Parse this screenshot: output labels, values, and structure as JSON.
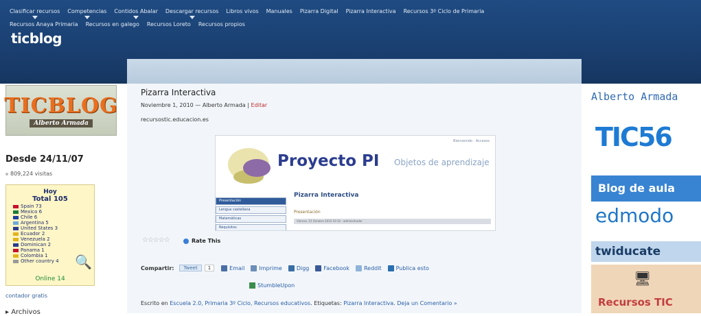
{
  "nav": {
    "row1": [
      {
        "label": "Clasificar recursos",
        "arrow": true
      },
      {
        "label": "Competencias",
        "arrow": true
      },
      {
        "label": "Contidos Abalar",
        "arrow": true
      },
      {
        "label": "Descargar recursos",
        "arrow": true
      },
      {
        "label": "Libros vivos",
        "arrow": false
      },
      {
        "label": "Manuales",
        "arrow": false
      },
      {
        "label": "Pizarra Digital",
        "arrow": false
      },
      {
        "label": "Pizarra Interactiva",
        "arrow": false
      },
      {
        "label": "Recursos 3º Ciclo de Primaria",
        "arrow": false
      }
    ],
    "row2": [
      {
        "label": "Recursos Anaya Primaria"
      },
      {
        "label": "Recursos en galego"
      },
      {
        "label": "Recursos Loreto"
      },
      {
        "label": "Recursos propios"
      }
    ]
  },
  "site": {
    "title": "ticblog"
  },
  "left": {
    "logo_big": "TICBLOG",
    "logo_small": "Alberto Armada",
    "since": "Desde 24/11/07",
    "visits": "809,224 visitas",
    "counter": {
      "hoy": "Hoy",
      "total": "Total 105",
      "rows": [
        {
          "label": "Spain 73",
          "color": "#c8102e"
        },
        {
          "label": "Mexico 6",
          "color": "#1b7a3a"
        },
        {
          "label": "Chile 6",
          "color": "#1f3fa0"
        },
        {
          "label": "Argentina 5",
          "color": "#6fa8dc"
        },
        {
          "label": "United States 3",
          "color": "#2b3b8f"
        },
        {
          "label": "Ecuador 2",
          "color": "#e3b21c"
        },
        {
          "label": "Venezuela 2",
          "color": "#e3b21c"
        },
        {
          "label": "Dominican 2",
          "color": "#2b3b8f"
        },
        {
          "label": "Panama 1",
          "color": "#c8102e"
        },
        {
          "label": "Colombia 1",
          "color": "#e3b21c"
        },
        {
          "label": "Other country 4",
          "color": "#999999"
        }
      ],
      "online": "Online 14"
    },
    "contador": "contador gratis",
    "archive": "Archivos"
  },
  "post": {
    "title": "Pizarra Interactiva",
    "date": "Noviembre 1, 2010",
    "dash": " — ",
    "author": "Alberto Armada",
    "sep": " | ",
    "edit": "Editar",
    "source": "recursostic.educacion.es",
    "shot": {
      "top_links": "Bienvenido · Accesos",
      "title": "Proyecto PI",
      "subtitle": "Objetos de aprendizaje",
      "menu": [
        "Presentación",
        "Lengua castellana",
        "Matemáticas",
        "Requisitos"
      ],
      "heading": "Pizarra Interactiva",
      "presentacion": "Presentación",
      "bar": "Viernes, 15 Octubre 2010 10:32  ·  administrador"
    },
    "rate": "Rate This",
    "share": {
      "label": "Compartir:",
      "tweet": "Tweet",
      "count": "1",
      "items": [
        {
          "label": "Email",
          "color": "#4a6fa5"
        },
        {
          "label": "Imprime",
          "color": "#6c8eb8"
        },
        {
          "label": "Digg",
          "color": "#3a6ea5"
        },
        {
          "label": "Facebook",
          "color": "#3b5998"
        },
        {
          "label": "Reddit",
          "color": "#8fb3d9"
        },
        {
          "label": "Publica esto",
          "color": "#2a6fb0"
        }
      ],
      "stumble": "StumbleUpon"
    },
    "filed": {
      "prefix": "Escrito en ",
      "cats": "Escuela 2.0, Primaria 3º Ciclo, Recursos educativos",
      "mid": ". Etiquetas: ",
      "tags": "Pizarra Interactiva",
      "sep": ". ",
      "comment": "Deja un Comentario »"
    }
  },
  "right": {
    "author": "Alberto Armada",
    "tic56": "TIC56",
    "blog_aula": "Blog de aula",
    "edmodo": "edmodo",
    "twiducate": "twiducate",
    "recursos": "Recursos TIC"
  }
}
